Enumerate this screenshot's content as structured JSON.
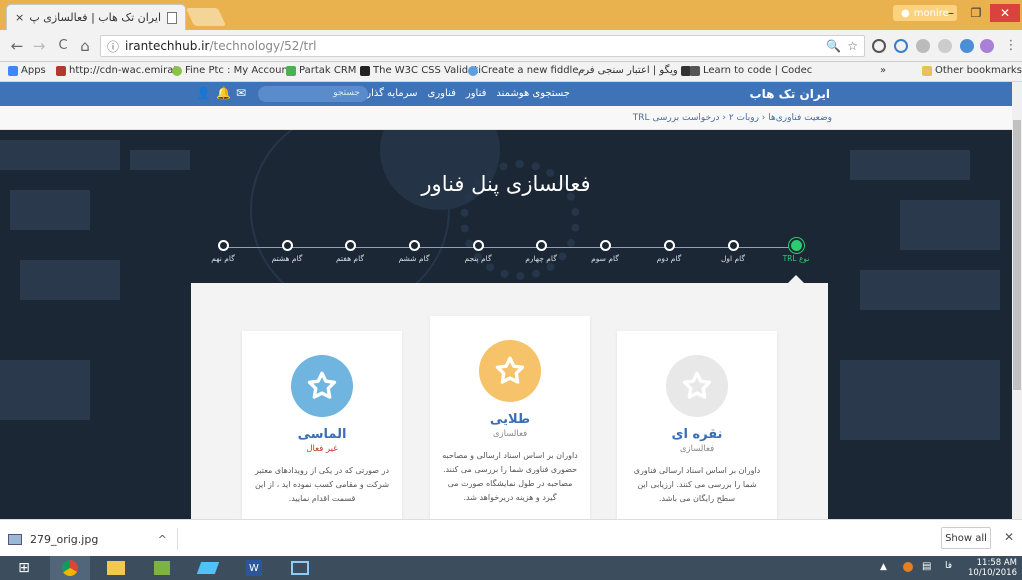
{
  "browser": {
    "tab_title": "ایران تک هاب | فعالسازی پ",
    "tab_close": "×",
    "user_name": "monire",
    "window_buttons": {
      "minimize": "–",
      "maximize": "❐",
      "close": "✕"
    },
    "url_host": "irantechhub.ir",
    "url_path": "/technology/52/trl",
    "nav_icons": {
      "back": "←",
      "forward": "→",
      "reload": "C",
      "home": "⌂",
      "info": "ⓘ",
      "star": "☆",
      "menu": "⋮"
    }
  },
  "bookmarks": {
    "items": [
      {
        "label": "Apps",
        "color": "#4285f4"
      },
      {
        "label": "http://cdn-wac.emirat",
        "color": "#b03a2e"
      },
      {
        "label": "Fine Ptc : My Account",
        "color": "#8bc34a"
      },
      {
        "label": "Partak CRM",
        "color": "#4caf50"
      },
      {
        "label": "The W3C CSS Validati",
        "color": "#222222"
      },
      {
        "label": "Create a new fiddle -",
        "color": "#5aa0e0"
      },
      {
        "label": "ویگو | اعتبار سنجی فرم",
        "color": "#333333"
      },
      {
        "label": "Learn to code | Codec",
        "color": "#555555"
      }
    ],
    "more": "»",
    "other": "Other bookmarks"
  },
  "site": {
    "brand": "ایران تک هاب",
    "nav": [
      "جستجوی هوشمند",
      "فناور",
      "فناوری",
      "سرمایه گذار"
    ],
    "search_placeholder": "جستجو",
    "header_icons": {
      "user": "👤",
      "bell": "🔔",
      "mail": "✉"
    },
    "breadcrumb": "وضعیت فناوری‌ها ‹ روبات ۲ ‹ درخواست بررسی TRL",
    "hero_title": "فعالسازی پنل فناور",
    "steps": [
      {
        "label": "نوع TRL",
        "active": true
      },
      {
        "label": "گام اول",
        "active": false
      },
      {
        "label": "گام دوم",
        "active": false
      },
      {
        "label": "گام سوم",
        "active": false
      },
      {
        "label": "گام چهارم",
        "active": false
      },
      {
        "label": "گام پنجم",
        "active": false
      },
      {
        "label": "گام ششم",
        "active": false
      },
      {
        "label": "گام هفتم",
        "active": false
      },
      {
        "label": "گام هشتم",
        "active": false
      },
      {
        "label": "گام نهم",
        "active": false
      }
    ],
    "cards": [
      {
        "title": "نقره ای",
        "status": "فعالسازی",
        "color": "#dcdcdc",
        "desc": "داوران بر اساس اسناد ارسالی فناوری شما را بررسی می کنند. ارزیابی این سطح رایگان می باشد."
      },
      {
        "title": "طلایی",
        "status": "فعالسازی",
        "color": "#f6c26a",
        "desc": "داوران بر اساس اسناد ارسالی و مصاحبه حضوری فناوری شما را بررسی می کنند. مصاحبه در طول نمایشگاه صورت می گیرد و هزینه دریرخواهد شد."
      },
      {
        "title": "الماسی",
        "status": "غیر فعال",
        "color": "#6fb5e0",
        "desc": "در صورتی که در یکی از رویدادهای معتبر شرکت و مقامی کسب نموده اید ، از این قسمت اقدام نمایید."
      }
    ]
  },
  "download": {
    "file": "279_orig.jpg",
    "chevron": "^",
    "show_all": "Show all",
    "close": "✕"
  },
  "taskbar": {
    "time": "11:58 AM",
    "date": "10/10/2016",
    "lang": "فا"
  }
}
